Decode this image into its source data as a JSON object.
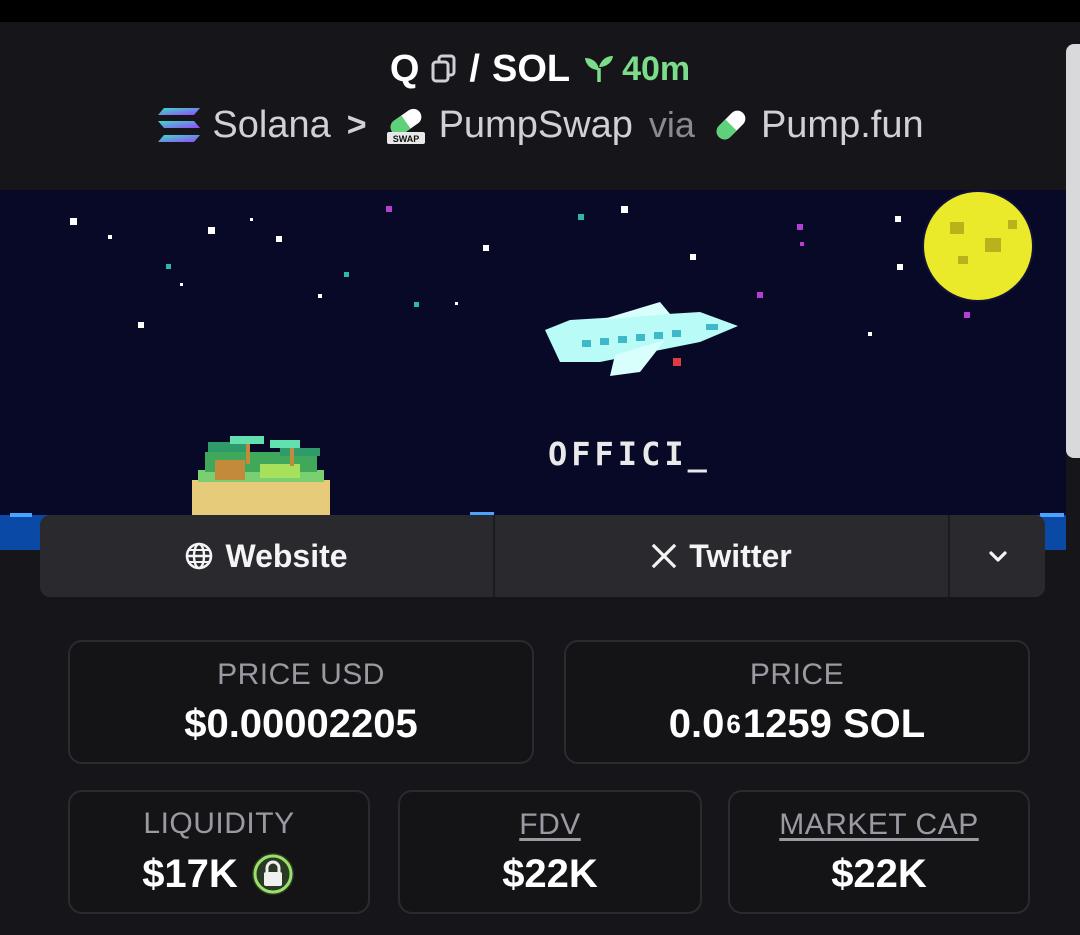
{
  "header": {
    "token_symbol": "Q",
    "separator": "/",
    "quote_symbol": "SOL",
    "age": "40m",
    "chain": "Solana",
    "chain_sep": ">",
    "dex": "PumpSwap",
    "via": "via",
    "launchpad": "Pump.fun",
    "icons": [
      "copy-icon",
      "seedling-icon",
      "solana-icon",
      "pumpswap-icon",
      "pill-icon"
    ]
  },
  "banner": {
    "text": "OFFICI_"
  },
  "links": {
    "website_label": "Website",
    "twitter_label": "Twitter",
    "icons": [
      "globe-icon",
      "x-icon",
      "chevron-down-icon"
    ]
  },
  "stats": {
    "price_usd_label": "PRICE USD",
    "price_usd_value": "$0.00002205",
    "price_label": "PRICE",
    "price_prefix": "0.0",
    "price_zeros": "6",
    "price_suffix": "1259 SOL",
    "liquidity_label": "LIQUIDITY",
    "liquidity_value": "$17K",
    "fdv_label": "FDV",
    "fdv_value": "$22K",
    "mcap_label": "MARKET CAP",
    "mcap_value": "$22K"
  },
  "colors": {
    "age_green": "#7bdc8a",
    "lock_green": "#9be06a",
    "background": "#16161a"
  }
}
